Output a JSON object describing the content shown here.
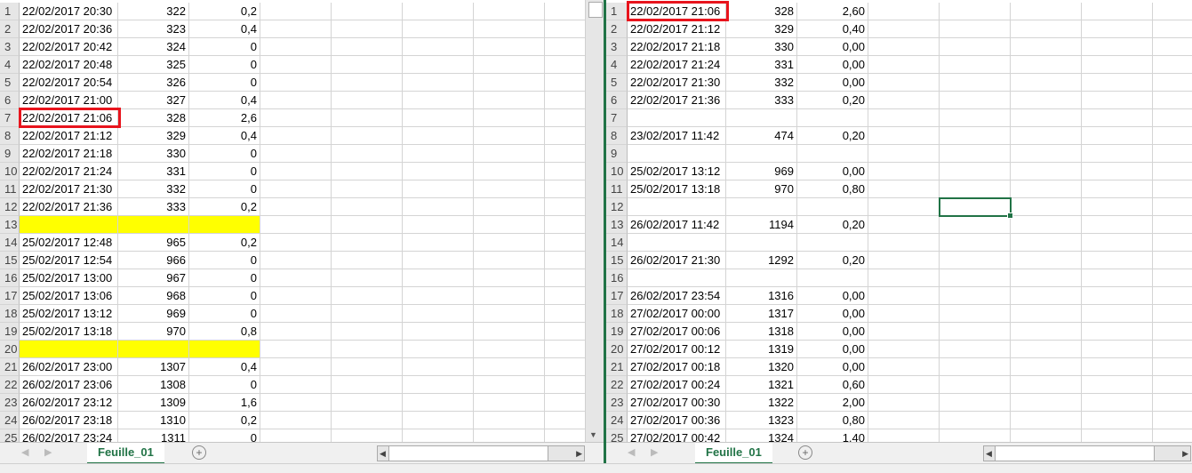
{
  "left": {
    "rows": [
      [
        "1",
        "22/02/2017 20:30",
        "322",
        "0,2"
      ],
      [
        "2",
        "22/02/2017 20:36",
        "323",
        "0,4"
      ],
      [
        "3",
        "22/02/2017 20:42",
        "324",
        "0"
      ],
      [
        "4",
        "22/02/2017 20:48",
        "325",
        "0"
      ],
      [
        "5",
        "22/02/2017 20:54",
        "326",
        "0"
      ],
      [
        "6",
        "22/02/2017 21:00",
        "327",
        "0,4"
      ],
      [
        "7",
        "22/02/2017 21:06",
        "328",
        "2,6"
      ],
      [
        "8",
        "22/02/2017 21:12",
        "329",
        "0,4"
      ],
      [
        "9",
        "22/02/2017 21:18",
        "330",
        "0"
      ],
      [
        "10",
        "22/02/2017 21:24",
        "331",
        "0"
      ],
      [
        "11",
        "22/02/2017 21:30",
        "332",
        "0"
      ],
      [
        "12",
        "22/02/2017 21:36",
        "333",
        "0,2"
      ],
      [
        "13",
        "",
        "",
        ""
      ],
      [
        "14",
        "25/02/2017 12:48",
        "965",
        "0,2"
      ],
      [
        "15",
        "25/02/2017 12:54",
        "966",
        "0"
      ],
      [
        "16",
        "25/02/2017 13:00",
        "967",
        "0"
      ],
      [
        "17",
        "25/02/2017 13:06",
        "968",
        "0"
      ],
      [
        "18",
        "25/02/2017 13:12",
        "969",
        "0"
      ],
      [
        "19",
        "25/02/2017 13:18",
        "970",
        "0,8"
      ],
      [
        "20",
        "",
        "",
        ""
      ],
      [
        "21",
        "26/02/2017 23:00",
        "1307",
        "0,4"
      ],
      [
        "22",
        "26/02/2017 23:06",
        "1308",
        "0"
      ],
      [
        "23",
        "26/02/2017 23:12",
        "1309",
        "1,6"
      ],
      [
        "24",
        "26/02/2017 23:18",
        "1310",
        "0,2"
      ],
      [
        "25",
        "26/02/2017 23:24",
        "1311",
        "0"
      ]
    ],
    "highlight_rows": [
      "13",
      "20"
    ],
    "highlight_color": "#ffff00",
    "boxed_row": "7",
    "sheet_tab": "Feuille_01"
  },
  "right": {
    "rows": [
      [
        "1",
        "22/02/2017 21:06",
        "328",
        "2,60"
      ],
      [
        "2",
        "22/02/2017 21:12",
        "329",
        "0,40"
      ],
      [
        "3",
        "22/02/2017 21:18",
        "330",
        "0,00"
      ],
      [
        "4",
        "22/02/2017 21:24",
        "331",
        "0,00"
      ],
      [
        "5",
        "22/02/2017 21:30",
        "332",
        "0,00"
      ],
      [
        "6",
        "22/02/2017 21:36",
        "333",
        "0,20"
      ],
      [
        "7",
        "",
        "",
        ""
      ],
      [
        "8",
        "23/02/2017 11:42",
        "474",
        "0,20"
      ],
      [
        "9",
        "",
        "",
        ""
      ],
      [
        "10",
        "25/02/2017 13:12",
        "969",
        "0,00"
      ],
      [
        "11",
        "25/02/2017 13:18",
        "970",
        "0,80"
      ],
      [
        "12",
        "",
        "",
        ""
      ],
      [
        "13",
        "26/02/2017 11:42",
        "1194",
        "0,20"
      ],
      [
        "14",
        "",
        "",
        ""
      ],
      [
        "15",
        "26/02/2017 21:30",
        "1292",
        "0,20"
      ],
      [
        "16",
        "",
        "",
        ""
      ],
      [
        "17",
        "26/02/2017 23:54",
        "1316",
        "0,00"
      ],
      [
        "18",
        "27/02/2017 00:00",
        "1317",
        "0,00"
      ],
      [
        "19",
        "27/02/2017 00:06",
        "1318",
        "0,00"
      ],
      [
        "20",
        "27/02/2017 00:12",
        "1319",
        "0,00"
      ],
      [
        "21",
        "27/02/2017 00:18",
        "1320",
        "0,00"
      ],
      [
        "22",
        "27/02/2017 00:24",
        "1321",
        "0,60"
      ],
      [
        "23",
        "27/02/2017 00:30",
        "1322",
        "2,00"
      ],
      [
        "24",
        "27/02/2017 00:36",
        "1323",
        "0,80"
      ],
      [
        "25",
        "27/02/2017 00:42",
        "1324",
        "1,40"
      ]
    ],
    "boxed_row": "1",
    "selected_cell": "E12",
    "sheet_tab": "Feuille_01"
  },
  "colors": {
    "accent": "#217346",
    "box": "#e8141d"
  }
}
